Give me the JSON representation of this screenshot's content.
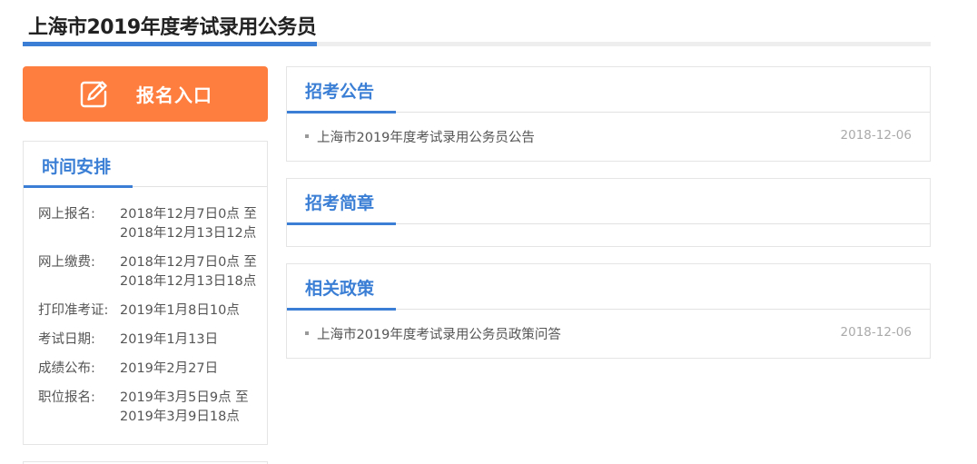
{
  "page_title": "上海市2019年度考试录用公务员",
  "register": {
    "label": "报名入口",
    "icon": "edit-icon"
  },
  "schedule": {
    "title": "时间安排",
    "items": [
      {
        "label": "网上报名:",
        "value": "2018年12月7日0点 至 2018年12月13日12点"
      },
      {
        "label": "网上缴费:",
        "value": "2018年12月7日0点 至 2018年12月13日18点"
      },
      {
        "label": "打印准考证:",
        "value": "2019年1月8日10点"
      },
      {
        "label": "考试日期:",
        "value": "2019年1月13日"
      },
      {
        "label": "成绩公布:",
        "value": "2019年2月27日"
      },
      {
        "label": "职位报名:",
        "value": "2019年3月5日9点 至 2019年3月9日18点"
      }
    ]
  },
  "sections": [
    {
      "title": "招考公告",
      "articles": [
        {
          "title": "上海市2019年度考试录用公务员公告",
          "date": "2018-12-06"
        }
      ]
    },
    {
      "title": "招考简章",
      "articles": []
    },
    {
      "title": "相关政策",
      "articles": [
        {
          "title": "上海市2019年度考试录用公务员政策问答",
          "date": "2018-12-06"
        }
      ]
    }
  ],
  "colors": {
    "accent": "#3a7fd5",
    "register_button": "#fd7e3f"
  }
}
